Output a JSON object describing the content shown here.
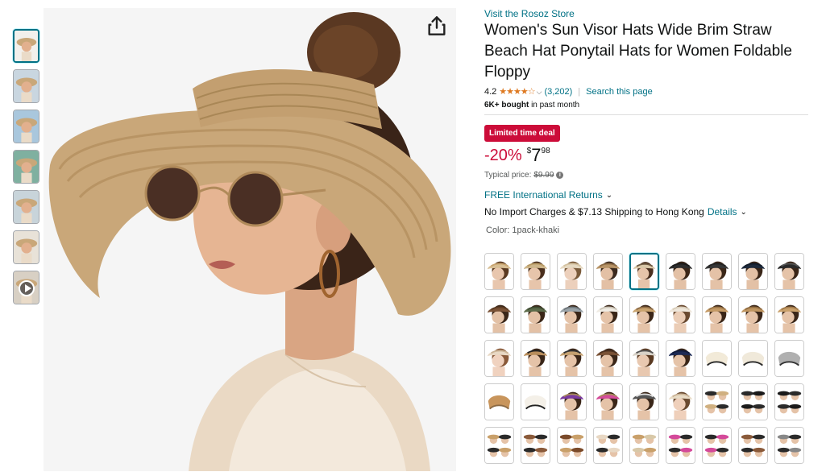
{
  "store_link": "Visit the Rosoz Store",
  "title": "Women's Sun Visor Hats Wide Brim Straw Beach Hat Ponytail Hats for Women Foldable Floppy",
  "rating": {
    "value": "4.2",
    "stars": "★★★★☆",
    "count": "(3,202)",
    "search_link": "Search this page"
  },
  "bought": {
    "bold": "6K+ bought",
    "rest": "in past month"
  },
  "deal_badge": "Limited time deal",
  "price": {
    "discount": "-20%",
    "currency": "$",
    "whole": "7",
    "fraction": "98",
    "typical_label": "Typical price:",
    "typical_value": "$9.99"
  },
  "returns": "FREE International Returns",
  "shipping": {
    "text": "No Import Charges & $7.13 Shipping to Hong Kong",
    "details": "Details"
  },
  "color": {
    "label": "Color:",
    "value": "1pack-khaki"
  },
  "swatches": [
    {
      "hat": "#d8bf95",
      "band": "#c8a46f",
      "skin": "#e8c6ad",
      "hair": "#5a3a22",
      "style": "visor"
    },
    {
      "hat": "#cdb58a",
      "band": "#b89a64",
      "skin": "#e7c5ab",
      "hair": "#4a2f1d",
      "style": "visor"
    },
    {
      "hat": "#e6d9c2",
      "band": "#d4c2a0",
      "skin": "#ecd0bc",
      "hair": "#7a5a3a",
      "style": "visor"
    },
    {
      "hat": "#b89467",
      "band": "#8c6a44",
      "skin": "#e3c0a5",
      "hair": "#3b2a1f",
      "style": "visor"
    },
    {
      "hat": "#d9c7a8",
      "band": "#6e5a42",
      "skin": "#e6c4aa",
      "hair": "#4a3020",
      "style": "visor"
    },
    {
      "hat": "#2d2d2d",
      "band": "#1a1a1a",
      "skin": "#e3c1a6",
      "hair": "#3a2618",
      "style": "visor"
    },
    {
      "hat": "#363636",
      "band": "#222",
      "skin": "#e4c2a7",
      "hair": "#3a2618",
      "style": "visor"
    },
    {
      "hat": "#1e2a3c",
      "band": "#111a28",
      "skin": "#e3c1a6",
      "hair": "#3a2618",
      "style": "visor"
    },
    {
      "hat": "#2a2a2a",
      "band": "#555",
      "skin": "#e5c3a8",
      "hair": "#3a2618",
      "style": "visor"
    },
    {
      "hat": "#7a5236",
      "band": "#5a3a22",
      "skin": "#e3c1a6",
      "hair": "#3a2618",
      "style": "visor"
    },
    {
      "hat": "#5c6b4a",
      "band": "#3e4a30",
      "skin": "#e3c1a6",
      "hair": "#3a2618",
      "style": "visor"
    },
    {
      "hat": "#9aa3a8",
      "band": "#6b7378",
      "skin": "#e5c3a8",
      "hair": "#3a2618",
      "style": "visor"
    },
    {
      "hat": "#f0ece4",
      "band": "#c9c2b4",
      "skin": "#e5c3a8",
      "hair": "#3a2618",
      "style": "visor"
    },
    {
      "hat": "#c9a36e",
      "band": "#8c6a44",
      "skin": "#e5c3a8",
      "hair": "#3a2618",
      "style": "visor"
    },
    {
      "hat": "#efe7db",
      "band": "#d8cdb9",
      "skin": "#ebcdb6",
      "hair": "#6a4a30",
      "style": "visor"
    },
    {
      "hat": "#c49a65",
      "band": "#9a7446",
      "skin": "#e5c3a8",
      "hair": "#3a2618",
      "style": "visor"
    },
    {
      "hat": "#bf9560",
      "band": "#8f6a3e",
      "skin": "#e5c3a8",
      "hair": "#3a2618",
      "style": "visor"
    },
    {
      "hat": "#c9a06a",
      "band": "#a07848",
      "skin": "#e5c3a8",
      "hair": "#3a2618",
      "style": "visor"
    },
    {
      "hat": "#e8d8c4",
      "band": "#c9b295",
      "skin": "#f0d2bf",
      "hair": "#8a5a3a",
      "style": "visor"
    },
    {
      "hat": "#b98e5c",
      "band": "#222",
      "skin": "#e5c3a8",
      "hair": "#3a2618",
      "style": "visor"
    },
    {
      "hat": "#c4a070",
      "band": "#333",
      "skin": "#e5c3a8",
      "hair": "#3a2618",
      "style": "visor"
    },
    {
      "hat": "#7a5236",
      "band": "#4a3020",
      "skin": "#e5c3a8",
      "hair": "#3a2618",
      "style": "visor"
    },
    {
      "hat": "#d8d2c8",
      "band": "#555",
      "skin": "#e8c8b0",
      "hair": "#5a3a22",
      "style": "visor"
    },
    {
      "hat": "#1c2a55",
      "band": "#0f1a3a",
      "skin": "#e5c3a8",
      "hair": "#3a2618",
      "style": "visor"
    },
    {
      "hat": "#f2ead8",
      "band": "#2a2a2a",
      "skin": "#fff",
      "hair": "#fff",
      "style": "flat"
    },
    {
      "hat": "#f0e9da",
      "band": "#2a2a2a",
      "skin": "#fff",
      "hair": "#fff",
      "style": "flat"
    },
    {
      "hat": "#b0b0b0",
      "band": "#333",
      "skin": "#fff",
      "hair": "#fff",
      "style": "flat"
    },
    {
      "hat": "#c8955c",
      "band": "#8c6a44",
      "skin": "#fff",
      "hair": "#fff",
      "style": "flat"
    },
    {
      "hat": "#f4f0e8",
      "band": "#222",
      "skin": "#fff",
      "hair": "#fff",
      "style": "flat"
    },
    {
      "hat": "#7a3aa0",
      "band": "#a78a5a",
      "skin": "#e5c3a8",
      "hair": "#3a2618",
      "style": "visor"
    },
    {
      "hat": "#d44a9a",
      "band": "#a78a5a",
      "skin": "#e5c3a8",
      "hair": "#3a2618",
      "style": "visor"
    },
    {
      "hat": "#555",
      "band": "#ddd",
      "skin": "#e5c3a8",
      "hair": "#3a2618",
      "style": "visor"
    },
    {
      "hat": "#e9dcc6",
      "band": "#c9b295",
      "skin": "#efd0bb",
      "hair": "#6a4a30",
      "style": "visor"
    },
    {
      "hat": "#2a2a2a",
      "band": "#d0b080",
      "skin": "#e5c3a8",
      "hair": "#3a2618",
      "style": "multi"
    },
    {
      "hat": "#2a2a2a",
      "band": "#1a1a1a",
      "skin": "#e5c3a8",
      "hair": "#3a2618",
      "style": "multi"
    },
    {
      "hat": "#1a1a1a",
      "band": "#2a2a2a",
      "skin": "#e5c3a8",
      "hair": "#3a2618",
      "style": "multi"
    },
    {
      "hat": "#c9a06a",
      "band": "#2a2a2a",
      "skin": "#e5c3a8",
      "hair": "#3a2618",
      "style": "multi"
    },
    {
      "hat": "#8a5a3a",
      "band": "#2a2a2a",
      "skin": "#e5c3a8",
      "hair": "#3a2618",
      "style": "multi"
    },
    {
      "hat": "#7a4a2a",
      "band": "#c9a06a",
      "skin": "#e5c3a8",
      "hair": "#3a2618",
      "style": "multi"
    },
    {
      "hat": "#e8d8c4",
      "band": "#2a2a2a",
      "skin": "#e5c3a8",
      "hair": "#3a2618",
      "style": "multi"
    },
    {
      "hat": "#c9a06a",
      "band": "#d8c8a8",
      "skin": "#e5c3a8",
      "hair": "#3a2618",
      "style": "multi"
    },
    {
      "hat": "#d44a9a",
      "band": "#2a2a2a",
      "skin": "#e5c3a8",
      "hair": "#3a2618",
      "style": "multi"
    },
    {
      "hat": "#2a2a2a",
      "band": "#d44a9a",
      "skin": "#e5c3a8",
      "hair": "#3a2618",
      "style": "multi"
    },
    {
      "hat": "#8a5a3a",
      "band": "#2a2a2a",
      "skin": "#e5c3a8",
      "hair": "#3a2618",
      "style": "multi"
    },
    {
      "hat": "#888",
      "band": "#2a2a2a",
      "skin": "#e5c3a8",
      "hair": "#3a2618",
      "style": "multi"
    }
  ],
  "selected_swatch": 4,
  "thumbnails": [
    {
      "kind": "product",
      "bg": "#f2f0ec"
    },
    {
      "kind": "detail",
      "bg": "#c9d6e0"
    },
    {
      "kind": "beach",
      "bg": "#a9c7dd"
    },
    {
      "kind": "lifestyle",
      "bg": "#7fb0a0"
    },
    {
      "kind": "beach2",
      "bg": "#c8d4da"
    },
    {
      "kind": "collage",
      "bg": "#e8e2d8"
    },
    {
      "kind": "video",
      "bg": "#d8d0c4"
    }
  ],
  "icons": {
    "share": "share-icon",
    "info": "info-icon",
    "chevron": "chevron-down-icon",
    "play": "play-icon"
  },
  "colors": {
    "link": "#007185",
    "deal": "#cc0c39",
    "star": "#de7921"
  }
}
